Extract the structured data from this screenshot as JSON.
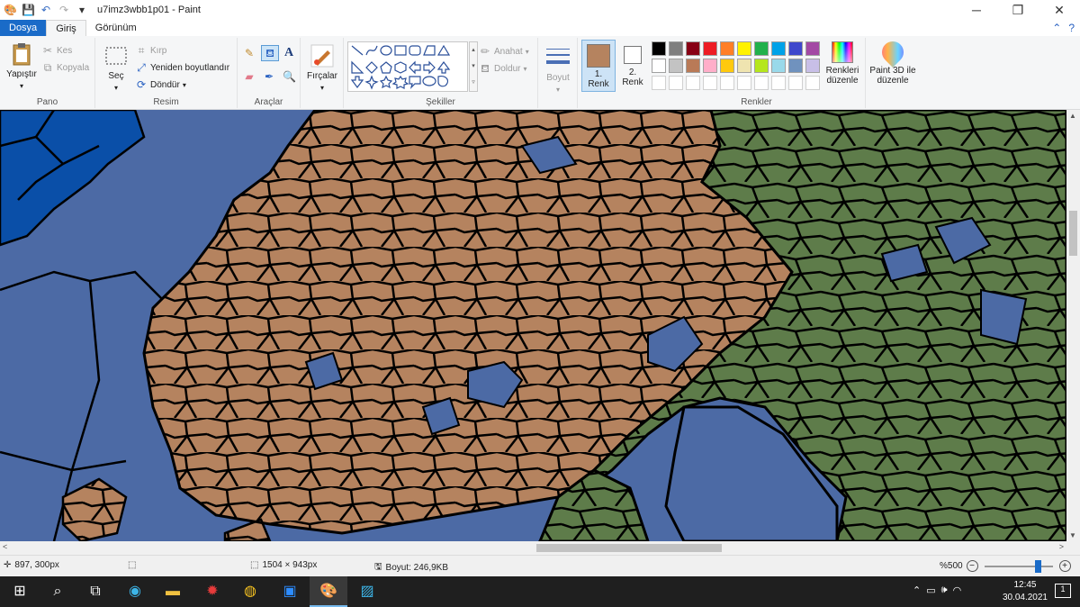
{
  "window": {
    "title": "u7imz3wbb1p01 - Paint",
    "controls": {
      "minimize": "─",
      "maximize": "❐",
      "close": "✕"
    }
  },
  "tabs": {
    "file": "Dosya",
    "home": "Giriş",
    "view": "Görünüm"
  },
  "ribbon": {
    "clipboard": {
      "label": "Pano",
      "paste": "Yapıştır",
      "cut": "Kes",
      "copy": "Kopyala"
    },
    "image": {
      "label": "Resim",
      "select": "Seç",
      "crop": "Kırp",
      "resize": "Yeniden boyutlandır",
      "rotate": "Döndür"
    },
    "tools": {
      "label": "Araçlar"
    },
    "brushes": {
      "label": "Fırçalar"
    },
    "shapes": {
      "label": "Şekiller",
      "outline": "Anahat",
      "fill": "Doldur"
    },
    "size": {
      "label": "Boyut"
    },
    "color1": {
      "line1": "1.",
      "line2": "Renk",
      "value": "#b5835f"
    },
    "color2": {
      "line1": "2.",
      "line2": "Renk",
      "value": "#ffffff"
    },
    "colors": {
      "label": "Renkler",
      "edit_line1": "Renkleri",
      "edit_line2": "düzenle",
      "palette_row1": [
        "#000000",
        "#7f7f7f",
        "#880015",
        "#ed1c24",
        "#ff7f27",
        "#fff200",
        "#22b14c",
        "#00a2e8",
        "#3f48cc",
        "#a349a4"
      ],
      "palette_row2": [
        "#ffffff",
        "#c3c3c3",
        "#b97a57",
        "#ffaec9",
        "#ffc90e",
        "#efe4b0",
        "#b5e61d",
        "#99d9ea",
        "#7092be",
        "#c8bfe7"
      ]
    },
    "paint3d": {
      "line1": "Paint 3D ile",
      "line2": "düzenle"
    }
  },
  "canvas": {
    "colors": {
      "sea": "#4c6aa5",
      "deep_sea": "#0a4fa8",
      "land_brown": "#b5835f",
      "land_green": "#5e7c4a",
      "border": "#000000"
    }
  },
  "statusbar": {
    "cursor_pos": "897, 300px",
    "image_size": "1504 × 943px",
    "file_size": "Boyut: 246,9KB",
    "zoom": "%500"
  },
  "taskbar": {
    "time": "12:45",
    "date": "30.04.2021",
    "notifications": "1"
  }
}
